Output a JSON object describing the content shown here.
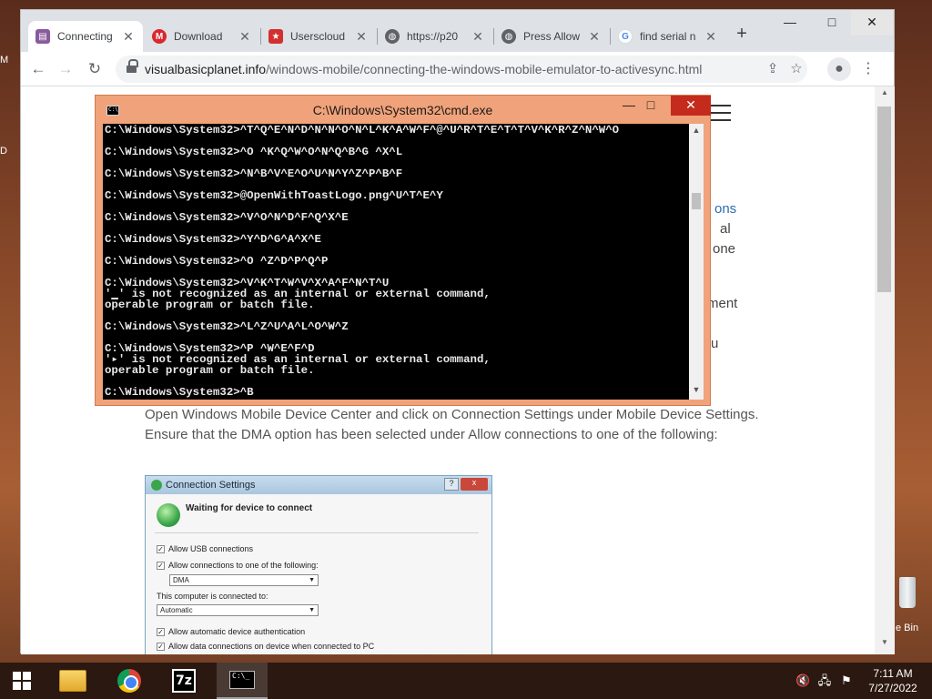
{
  "desktop": {
    "left_glyphs": [
      "M",
      "D"
    ],
    "recycle_bin_label": "e Bin"
  },
  "browser": {
    "tabs": [
      {
        "title": "Connecting",
        "icon": "site-favicon",
        "color": "#8a5a9e"
      },
      {
        "title": "Download",
        "icon": "mega-icon",
        "color": "#d9272e"
      },
      {
        "title": "Userscloud",
        "icon": "star-icon",
        "color": "#d32f2f"
      },
      {
        "title": "https://p20",
        "icon": "globe-icon",
        "color": "#5f6368"
      },
      {
        "title": "Press Allow",
        "icon": "globe-icon",
        "color": "#5f6368"
      },
      {
        "title": "find serial n",
        "icon": "google-icon",
        "color": "#4285f4"
      }
    ],
    "new_tab_label": "+",
    "window_controls": {
      "minimize": "—",
      "maximize": "□",
      "close": "✕"
    },
    "url_host": "visualbasicplanet.info",
    "url_path": "/windows-mobile/connecting-the-windows-mobile-emulator-to-activesync.html"
  },
  "page": {
    "right_fragments": [
      "ons",
      "al",
      "one",
      "ment",
      "u"
    ],
    "paragraph": "Open Windows Mobile Device Center and click on Connection Settings under Mobile Device Settings. Ensure that the DMA option has been selected under Allow connections to one of the following:",
    "figure": {
      "title": "Connection Settings",
      "help": "?",
      "close": "x",
      "waiting": "Waiting for device to connect",
      "allow_usb": "Allow USB connections",
      "allow_one_of": "Allow connections to one of the following:",
      "connection_value": "DMA",
      "connected_to_label": "This computer is connected to:",
      "connected_to_value": "Automatic",
      "allow_auth": "Allow automatic device authentication",
      "allow_data": "Allow data connections on device when connected to PC"
    }
  },
  "cmd": {
    "title": "C:\\Windows\\System32\\cmd.exe",
    "icon_text": "C:\\",
    "lines": [
      "C:\\Windows\\System32>^T^Q^E^N^D^N^N^O^N^L^K^A^W^F^@^U^R^T^E^T^T^V^K^R^Z^N^W^O",
      "",
      "C:\\Windows\\System32>^O ^K^Q^W^O^N^Q^B^G ^X^L",
      "",
      "C:\\Windows\\System32>^N^B^V^E^O^U^N^Y^Z^P^B^F",
      "",
      "C:\\Windows\\System32>@OpenWithToastLogo.png^U^T^E^Y",
      "",
      "C:\\Windows\\System32>^V^O^N^D^F^Q^X^E",
      "",
      "C:\\Windows\\System32>^Y^D^G^A^X^E",
      "",
      "C:\\Windows\\System32>^O ^Z^D^P^Q^P",
      "",
      "C:\\Windows\\System32>^V^K^T^W^V^X^A^F^N^T^U",
      "'▁' is not recognized as an internal or external command,",
      "operable program or batch file.",
      "",
      "C:\\Windows\\System32>^L^Z^U^A^L^O^W^Z",
      "",
      "C:\\Windows\\System32>^P ^W^E^F^D",
      "'▸' is not recognized as an internal or external command,",
      "operable program or batch file.",
      "",
      "C:\\Windows\\System32>^B"
    ]
  },
  "taskbar": {
    "clock_time": "7:11 AM",
    "clock_date": "7/27/2022",
    "z7_label": "7z",
    "cmd_icon_text": "C:\\_"
  }
}
